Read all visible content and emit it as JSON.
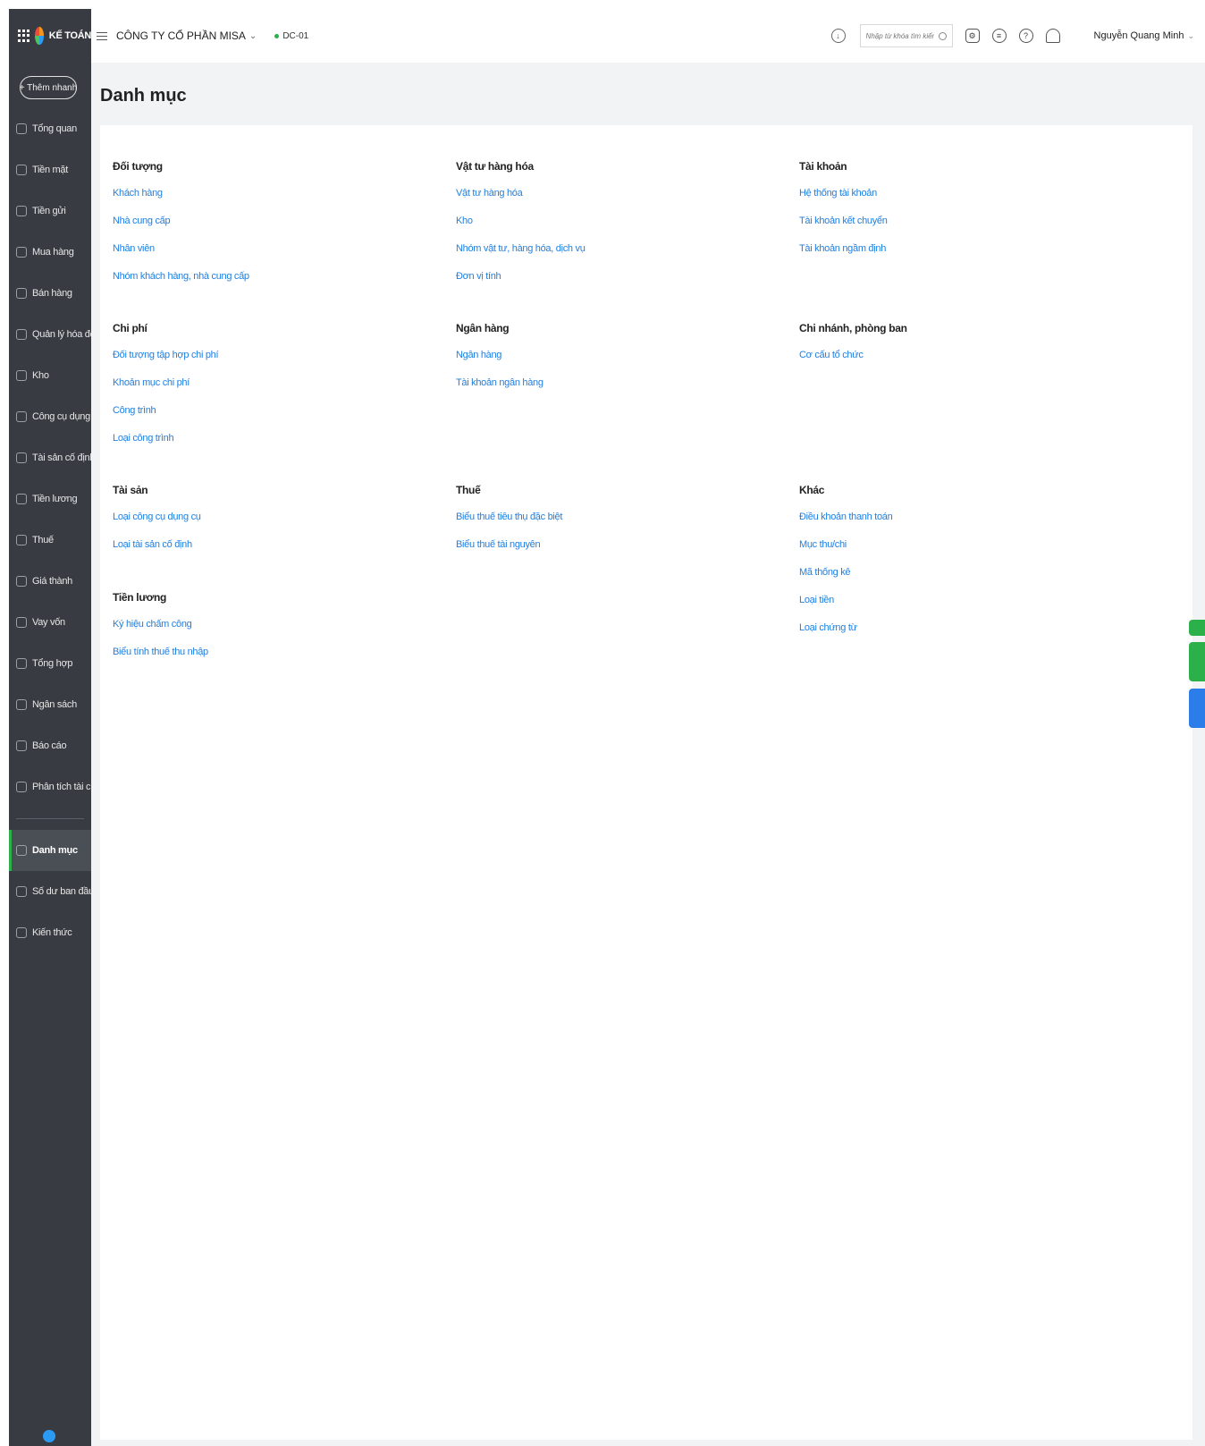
{
  "sidebar": {
    "brand": "KẾ TOÁN",
    "quick_add": "+ Thêm nhanh",
    "items": [
      {
        "label": "Tổng quan",
        "icon": "dashboard-icon"
      },
      {
        "label": "Tiền mặt",
        "icon": "cash-icon"
      },
      {
        "label": "Tiền gửi",
        "icon": "bank-icon"
      },
      {
        "label": "Mua hàng",
        "icon": "purchase-icon"
      },
      {
        "label": "Bán hàng",
        "icon": "cart-icon"
      },
      {
        "label": "Quản lý hóa đơn",
        "icon": "invoice-icon"
      },
      {
        "label": "Kho",
        "icon": "warehouse-icon"
      },
      {
        "label": "Công cụ dụng cụ",
        "icon": "tools-icon"
      },
      {
        "label": "Tài sản cố định",
        "icon": "asset-icon"
      },
      {
        "label": "Tiền lương",
        "icon": "salary-icon"
      },
      {
        "label": "Thuế",
        "icon": "tax-icon"
      },
      {
        "label": "Giá thành",
        "icon": "cost-icon"
      },
      {
        "label": "Vay vốn",
        "icon": "loan-icon"
      },
      {
        "label": "Tổng hợp",
        "icon": "summary-icon"
      },
      {
        "label": "Ngân sách",
        "icon": "budget-icon"
      },
      {
        "label": "Báo cáo",
        "icon": "report-icon"
      },
      {
        "label": "Phân tích tài chính",
        "icon": "analysis-icon"
      }
    ],
    "items_bottom": [
      {
        "label": "Danh mục",
        "icon": "list-icon",
        "active": true
      },
      {
        "label": "Số dư ban đầu",
        "icon": "balance-icon"
      },
      {
        "label": "Kiến thức",
        "icon": "knowledge-icon"
      }
    ]
  },
  "header": {
    "company": "CÔNG TY CỔ PHẦN MISA",
    "branch": "DC-01",
    "search_placeholder": "Nhập từ khóa tìm kiếm",
    "user": "Nguyễn Quang Minh"
  },
  "page": {
    "title": "Danh mục",
    "groups": [
      {
        "title": "Đối tượng",
        "links": [
          "Khách hàng",
          "Nhà cung cấp",
          "Nhân viên",
          "Nhóm khách hàng, nhà cung cấp"
        ]
      },
      {
        "title": "Vật tư hàng hóa",
        "links": [
          "Vật tư hàng hóa",
          "Kho",
          "Nhóm vật tư, hàng hóa, dịch vụ",
          "Đơn vị tính"
        ]
      },
      {
        "title": "Tài khoản",
        "links": [
          "Hệ thống tài khoản",
          "Tài khoản kết chuyển",
          "Tài khoản ngầm định"
        ]
      },
      {
        "title": "Chi phí",
        "links": [
          "Đối tượng tập hợp chi phí",
          "Khoản mục chi phí",
          "Công trình",
          "Loại công trình"
        ]
      },
      {
        "title": "Ngân hàng",
        "links": [
          "Ngân hàng",
          "Tài khoản ngân hàng"
        ]
      },
      {
        "title": "Chi nhánh, phòng ban",
        "links": [
          "Cơ cấu tổ chức"
        ]
      },
      {
        "title": "Tài sản",
        "links": [
          "Loại công cụ dụng cụ",
          "Loại tài sản cố định"
        ]
      },
      {
        "title": "Thuế",
        "links": [
          "Biểu thuế tiêu thụ đặc biệt",
          "Biểu thuế tài nguyên"
        ]
      },
      {
        "title": "Khác",
        "links": [
          "Điều khoản thanh toán",
          "Mục thu/chi",
          "Mã thống kê",
          "Loại tiền",
          "Loại chứng từ"
        ]
      },
      {
        "title": "Tiền lương",
        "links": [
          "Ký hiệu chấm công",
          "Biểu tính thuế thu nhập"
        ]
      }
    ]
  },
  "colors": {
    "sidebar_bg": "#383c42",
    "link": "#1f7fe0",
    "accent_green": "#2bb04a",
    "accent_blue": "#2b7de9"
  }
}
